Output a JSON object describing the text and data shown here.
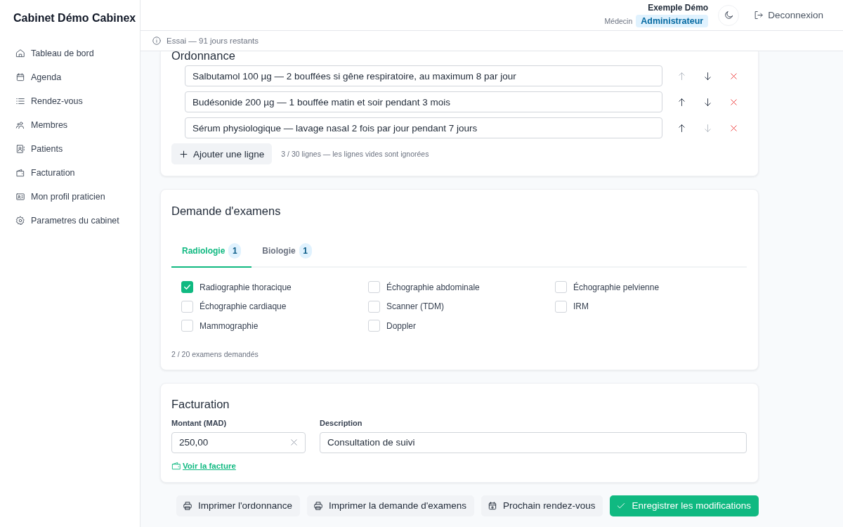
{
  "sidebar": {
    "title": "Cabinet Démo Cabinex",
    "items": [
      {
        "label": "Tableau de bord"
      },
      {
        "label": "Agenda"
      },
      {
        "label": "Rendez-vous"
      },
      {
        "label": "Membres"
      },
      {
        "label": "Patients"
      },
      {
        "label": "Facturation"
      },
      {
        "label": "Mon profil praticien"
      },
      {
        "label": "Parametres du cabinet"
      }
    ]
  },
  "header": {
    "user_name": "Exemple Démo",
    "role": "Médecin",
    "badge": "Administrateur",
    "logout": "Deconnexion"
  },
  "trial_bar": {
    "text": "Essai — 91 jours restants"
  },
  "prescription": {
    "title": "Ordonnance",
    "lines": [
      {
        "value": "Salbutamol 100 µg — 2 bouffées si gêne respiratoire, au maximum 8 par jour",
        "up_disabled": true,
        "down_disabled": false
      },
      {
        "value": "Budésonide 200 µg — 1 bouffée matin et soir pendant 3 mois",
        "up_disabled": false,
        "down_disabled": false
      },
      {
        "value": "Sérum physiologique — lavage nasal 2 fois par jour pendant 7 jours",
        "up_disabled": false,
        "down_disabled": true
      }
    ],
    "add_button": "Ajouter une ligne",
    "counter": "3 / 30 lignes — les lignes vides sont ignorées"
  },
  "exams": {
    "title": "Demande d'examens",
    "tabs": [
      {
        "label": "Radiologie",
        "count": "1",
        "selected": true
      },
      {
        "label": "Biologie",
        "count": "1",
        "selected": false
      }
    ],
    "items": [
      {
        "label": "Radiographie thoracique",
        "checked": true
      },
      {
        "label": "Échographie abdominale",
        "checked": false
      },
      {
        "label": "Échographie pelvienne",
        "checked": false
      },
      {
        "label": "Échographie cardiaque",
        "checked": false
      },
      {
        "label": "Scanner (TDM)",
        "checked": false
      },
      {
        "label": "IRM",
        "checked": false
      },
      {
        "label": "Mammographie",
        "checked": false
      },
      {
        "label": "Doppler",
        "checked": false
      }
    ],
    "counter": "2 / 20 examens demandés"
  },
  "billing": {
    "title": "Facturation",
    "amount_label": "Montant (MAD)",
    "amount": "250,00",
    "description_label": "Description",
    "description": "Consultation de suivi",
    "invoice_link": "Voir la facture"
  },
  "actions": [
    {
      "label": "Imprimer l'ordonnance",
      "kind": "secondary"
    },
    {
      "label": "Imprimer la demande d'examens",
      "kind": "secondary"
    },
    {
      "label": "Prochain rendez-vous",
      "kind": "secondary"
    },
    {
      "label": "Enregistrer les modifications",
      "kind": "primary"
    }
  ]
}
